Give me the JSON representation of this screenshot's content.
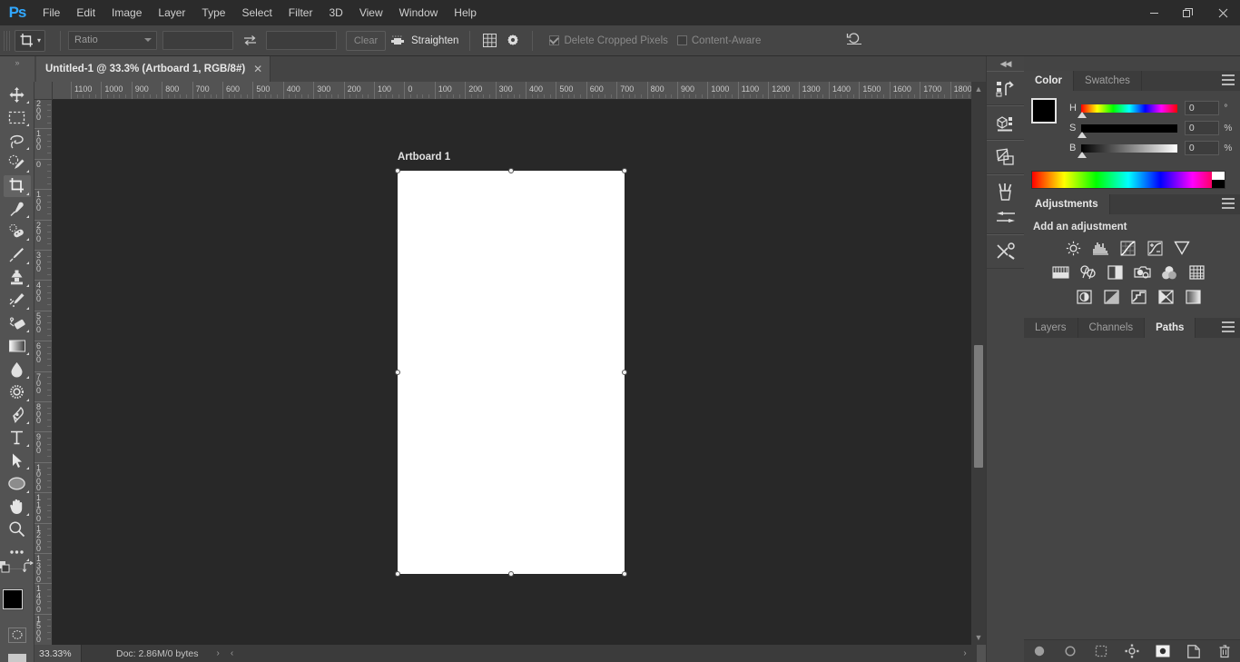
{
  "app": {
    "logo": "Ps"
  },
  "menubar": {
    "items": [
      "File",
      "Edit",
      "Image",
      "Layer",
      "Type",
      "Select",
      "Filter",
      "3D",
      "View",
      "Window",
      "Help"
    ]
  },
  "window_controls": {
    "minimize": "—",
    "maximize": "❐",
    "close": "✕"
  },
  "options_bar": {
    "tool_icon": "crop-tool-icon",
    "ratio_select": "Ratio",
    "width_field": "",
    "height_field": "",
    "swap_icon": "swap-arrows-icon",
    "clear_label": "Clear",
    "straighten_label": "Straighten",
    "overlay_icon": "grid-overlay-icon",
    "settings_icon": "gear-icon",
    "delete_cropped_label": "Delete Cropped Pixels",
    "delete_cropped_checked": true,
    "content_aware_label": "Content-Aware",
    "content_aware_checked": false,
    "reset_icon": "reset-icon",
    "search_icon": "search-icon",
    "workspace_icon": "workspace-icon"
  },
  "document_tab": {
    "title": "Untitled-1 @ 33.3% (Artboard 1, RGB/8#)",
    "close": "✕"
  },
  "rulers": {
    "horizontal_labels": [
      "1100",
      "1000",
      "900",
      "800",
      "700",
      "600",
      "500",
      "400",
      "300",
      "200",
      "100",
      "0",
      "100",
      "200",
      "300",
      "400",
      "500",
      "600",
      "700",
      "800",
      "900",
      "1000",
      "1100",
      "1200",
      "1300",
      "1400",
      "1500",
      "1600",
      "1700",
      "1800"
    ],
    "vertical_labels": [
      "200",
      "100",
      "0",
      "100",
      "200",
      "300",
      "400",
      "500",
      "600",
      "700",
      "800",
      "900",
      "1000",
      "1100",
      "1200",
      "1300",
      "1400",
      "1500"
    ]
  },
  "toolbar": {
    "tools": [
      {
        "name": "move-tool",
        "active": false
      },
      {
        "name": "rectangular-marquee-tool",
        "active": false
      },
      {
        "name": "lasso-tool",
        "active": false
      },
      {
        "name": "quick-selection-tool",
        "active": false
      },
      {
        "name": "crop-tool",
        "active": true
      },
      {
        "name": "eyedropper-tool",
        "active": false
      },
      {
        "name": "spot-healing-brush-tool",
        "active": false
      },
      {
        "name": "brush-tool",
        "active": false
      },
      {
        "name": "clone-stamp-tool",
        "active": false
      },
      {
        "name": "history-brush-tool",
        "active": false
      },
      {
        "name": "eraser-tool",
        "active": false
      },
      {
        "name": "gradient-tool",
        "active": false
      },
      {
        "name": "blur-tool",
        "active": false
      },
      {
        "name": "dodge-tool",
        "active": false
      },
      {
        "name": "pen-tool",
        "active": false
      },
      {
        "name": "type-tool",
        "active": false
      },
      {
        "name": "path-selection-tool",
        "active": false
      },
      {
        "name": "ellipse-tool",
        "active": false
      },
      {
        "name": "hand-tool",
        "active": false
      },
      {
        "name": "zoom-tool",
        "active": false
      },
      {
        "name": "edit-toolbar-tool",
        "active": false
      }
    ],
    "foreground_color": "#000000",
    "background_color": "#ffffff",
    "quick_mask": "quick-mask-icon",
    "screen_mode": "screen-mode-icon"
  },
  "canvas": {
    "artboard_label": "Artboard 1",
    "artboard_fill": "#ffffff",
    "background": "#282828"
  },
  "status_bar": {
    "zoom": "33.33%",
    "doc_info": "Doc: 2.86M/0 bytes",
    "expand_arrow": "›",
    "left_arrow": "‹",
    "right_arrow": "›"
  },
  "icon_dock": {
    "collapse_icon": "collapse-arrows-icon",
    "buttons": [
      {
        "name": "history-panel-icon"
      },
      {
        "name": "3d-panel-icon"
      },
      {
        "name": "properties-panel-icon"
      },
      {
        "name": "brush-presets-icon"
      },
      {
        "name": "brush-settings-icon"
      },
      {
        "name": "tool-presets-icon"
      }
    ]
  },
  "color_panel": {
    "tabs": [
      {
        "label": "Color",
        "active": true
      },
      {
        "label": "Swatches",
        "active": false
      }
    ],
    "menu_icon": "panel-menu-icon",
    "foreground": "#000000",
    "background": "#ffffff",
    "sliders": [
      {
        "label": "H",
        "value": "0",
        "unit": "°"
      },
      {
        "label": "S",
        "value": "0",
        "unit": "%"
      },
      {
        "label": "B",
        "value": "0",
        "unit": "%"
      }
    ]
  },
  "adjustments_panel": {
    "tab": "Adjustments",
    "menu_icon": "panel-menu-icon",
    "subtitle": "Add an adjustment",
    "rows": [
      [
        {
          "name": "brightness-contrast-icon"
        },
        {
          "name": "levels-icon"
        },
        {
          "name": "curves-icon"
        },
        {
          "name": "exposure-icon"
        },
        {
          "name": "vibrance-icon"
        }
      ],
      [
        {
          "name": "hue-saturation-icon"
        },
        {
          "name": "color-balance-icon"
        },
        {
          "name": "black-white-icon"
        },
        {
          "name": "photo-filter-icon"
        },
        {
          "name": "channel-mixer-icon"
        },
        {
          "name": "color-lookup-icon"
        }
      ],
      [
        {
          "name": "invert-icon"
        },
        {
          "name": "posterize-icon"
        },
        {
          "name": "threshold-icon"
        },
        {
          "name": "selective-color-icon"
        },
        {
          "name": "gradient-map-icon"
        }
      ]
    ]
  },
  "layers_panel": {
    "tabs": [
      {
        "label": "Layers",
        "active": false
      },
      {
        "label": "Channels",
        "active": false
      },
      {
        "label": "Paths",
        "active": true
      }
    ],
    "menu_icon": "panel-menu-icon",
    "bottom_buttons": [
      {
        "name": "fill-path-icon"
      },
      {
        "name": "stroke-path-icon"
      },
      {
        "name": "load-path-as-selection-icon"
      },
      {
        "name": "make-work-path-icon"
      },
      {
        "name": "add-layer-mask-icon"
      },
      {
        "name": "create-new-path-icon"
      },
      {
        "name": "delete-path-icon"
      }
    ]
  }
}
